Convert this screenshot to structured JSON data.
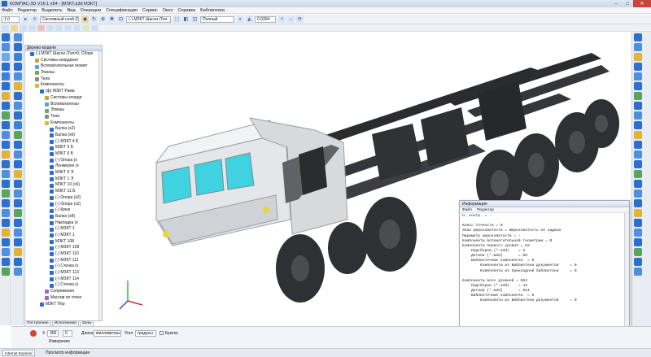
{
  "window": {
    "title": "КОМПАС-3D V16.1 x64 - [МЗКТ.а3d МЗКТ]",
    "minimize": "–",
    "maximize": "□",
    "close": "✕"
  },
  "menu": [
    "Файл",
    "Редактор",
    "Выделить",
    "Вид",
    "Операции",
    "Спецификация",
    "Сервис",
    "Окно",
    "Справка",
    "Библиотеки"
  ],
  "toolbar": {
    "scale": "1.0",
    "coord_system": "Системный слой (0)",
    "part_combo": "(-) МЗКТ Шасси (Тел",
    "view_mode": "Полный",
    "zoom": "0.0304"
  },
  "tree": {
    "header": "Дерево модели",
    "rows": [
      {
        "label": "(-) МЗКТ Шасси (Тел=0, Сборк",
        "depth": 1,
        "color": "#2d6bd1"
      },
      {
        "label": "Системы координат",
        "depth": 2,
        "color": "#c9a33a"
      },
      {
        "label": "Вспомогательная геомет",
        "depth": 2,
        "color": "#5aa0e0"
      },
      {
        "label": "Эскизы",
        "depth": 2,
        "color": "#6fae4c"
      },
      {
        "label": "Тела",
        "depth": 2,
        "color": "#8a8a8a"
      },
      {
        "label": "Компоненты",
        "depth": 2,
        "color": "#e0b63a"
      },
      {
        "label": "(ф) МЗКТ Рама",
        "depth": 3,
        "color": "#2d6bd1"
      },
      {
        "label": "Системы коорди",
        "depth": 4,
        "color": "#c9a33a"
      },
      {
        "label": "Вспомогательн",
        "depth": 4,
        "color": "#5aa0e0"
      },
      {
        "label": "Эскизы",
        "depth": 4,
        "color": "#6fae4c"
      },
      {
        "label": "Тела",
        "depth": 4,
        "color": "#8a8a8a"
      },
      {
        "label": "Компоненты",
        "depth": 4,
        "color": "#e0b63a"
      },
      {
        "label": "Балка (x2)",
        "depth": 5,
        "color": "#2d6bd1"
      },
      {
        "label": "Балка (x6)",
        "depth": 5,
        "color": "#2d6bd1"
      },
      {
        "label": "(-) МЗКТ 4 Б",
        "depth": 5,
        "color": "#2d6bd1"
      },
      {
        "label": "МЗКТ 5 Б",
        "depth": 5,
        "color": "#2d6bd1"
      },
      {
        "label": "МЗКТ 6 Б",
        "depth": 5,
        "color": "#2d6bd1"
      },
      {
        "label": "(-) Опора (x",
        "depth": 5,
        "color": "#2d6bd1"
      },
      {
        "label": "Лонжерон (x",
        "depth": 5,
        "color": "#2d6bd1"
      },
      {
        "label": "МЗКТ 9 Э",
        "depth": 5,
        "color": "#2d6bd1"
      },
      {
        "label": "МЗКТ 1 Э",
        "depth": 5,
        "color": "#2d6bd1"
      },
      {
        "label": "МЗКТ 10 (x6)",
        "depth": 5,
        "color": "#2d6bd1"
      },
      {
        "label": "МЗКТ 11 Б",
        "depth": 5,
        "color": "#2d6bd1"
      },
      {
        "label": "(-) Опора (x2)",
        "depth": 5,
        "color": "#2d6bd1"
      },
      {
        "label": "(-) Опора (x2)",
        "depth": 5,
        "color": "#2d6bd1"
      },
      {
        "label": "(-) Крюк",
        "depth": 5,
        "color": "#2d6bd1"
      },
      {
        "label": "Балка (x8)",
        "depth": 5,
        "color": "#2d6bd1"
      },
      {
        "label": "Накладка (x",
        "depth": 5,
        "color": "#2d6bd1"
      },
      {
        "label": "(-) МЗКТ 1",
        "depth": 5,
        "color": "#2d6bd1"
      },
      {
        "label": "(-) МЗКТ 1",
        "depth": 5,
        "color": "#2d6bd1"
      },
      {
        "label": "МЗКТ 108",
        "depth": 5,
        "color": "#2d6bd1"
      },
      {
        "label": "(-) МЗКТ 109",
        "depth": 5,
        "color": "#2d6bd1"
      },
      {
        "label": "(-) МЗКТ 110",
        "depth": 5,
        "color": "#2d6bd1"
      },
      {
        "label": "(-) МЗКТ 111",
        "depth": 5,
        "color": "#2d6bd1"
      },
      {
        "label": "(-) Стенка (x",
        "depth": 5,
        "color": "#2d6bd1"
      },
      {
        "label": "(-) МЗКТ 113",
        "depth": 5,
        "color": "#2d6bd1"
      },
      {
        "label": "(-) МЗКТ 114",
        "depth": 5,
        "color": "#2d6bd1"
      },
      {
        "label": "(-) Стенка (x",
        "depth": 5,
        "color": "#2d6bd1"
      },
      {
        "label": "Сопряжения",
        "depth": 4,
        "color": "#9a6bc2"
      },
      {
        "label": "Массив по точке",
        "depth": 4,
        "color": "#9a6bc2"
      },
      {
        "label": "МЗКТ Пер",
        "depth": 3,
        "color": "#2d6bd1"
      }
    ],
    "tabs": [
      "Построение",
      "Исполнения",
      "Зоны"
    ]
  },
  "props": {
    "x_label": "Х",
    "x_value": "300",
    "y_value": "0",
    "length_label": "Длина",
    "length_unit": "миллиметры",
    "angle_label": "Угол",
    "angle_unit": "градусы",
    "short_label": "Кратко",
    "measure_button": "Измерение"
  },
  "status": {
    "text": "Просмотр информации",
    "taskbar_item": "Internet Explorer"
  },
  "info": {
    "title": "Информация",
    "menu": [
      "Файл",
      "Редактор"
    ],
    "lines": [
      "Н. контр. = -",
      "",
      "Класс точности = 0",
      "Знак шероховатости = Шероховатость не задана",
      "Параметр шероховатости = -",
      "Компоненты вспомогательной геометрии = 0",
      "Компоненты первого уровня = 63",
      "    Подсборки (*.a3d)    = 3",
      "    Детали (*.m3d)       = 60",
      "    Библиотечные компоненты  = 0",
      "        Компоненты из Библиотеки документов     = 0",
      "        Компоненты из прикладной библиотеки     = 0",
      "",
      "Компоненты всех уровней = 964",
      "    Подсборки (*.a3d)    = 44",
      "    Детали (*.m3d)       = 914",
      "    Библиотечные компоненты  = 6",
      "        Компоненты из Библиотеки документов     = 0"
    ]
  },
  "colors": {
    "accent": "#2b63b5",
    "chassis": "#2a2c2e",
    "cab": "#e4e6e9",
    "glass": "#3fd3e2",
    "tyre": "#2e3033",
    "close": "#c9463d"
  }
}
